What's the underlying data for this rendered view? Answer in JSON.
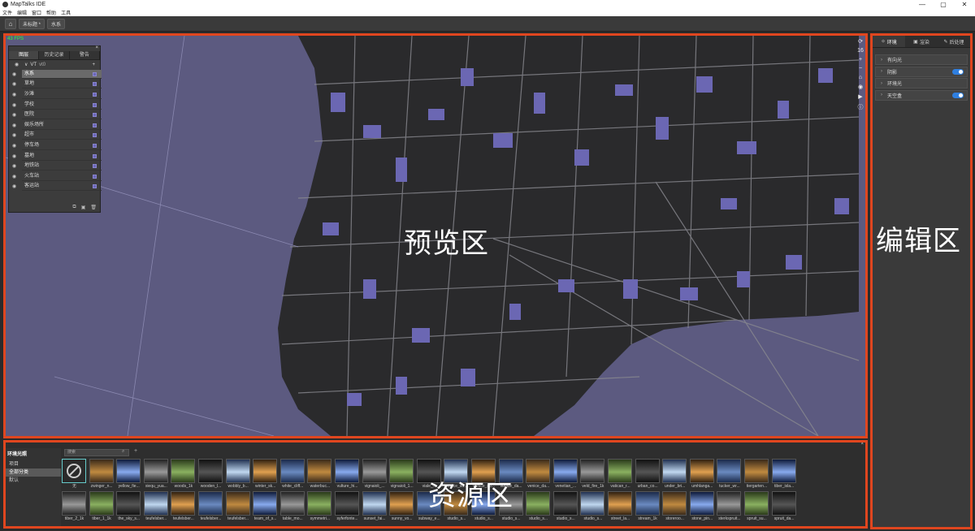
{
  "window": {
    "title": "MapTalks IDE",
    "controls": [
      "—",
      "▢",
      "✕"
    ]
  },
  "menu": [
    "文件",
    "编辑",
    "窗口",
    "帮助",
    "工具"
  ],
  "toolbar": {
    "home_icon": "home-icon",
    "scene_label": "未标题 *",
    "layer_label": "水系"
  },
  "preview": {
    "fps": "43 FPS",
    "zone_label": "预览区",
    "controls": [
      "⟳",
      "16",
      "+",
      "−",
      "⌂",
      "◉",
      "▶",
      "ⓘ"
    ]
  },
  "layers_panel": {
    "tabs": [
      "图层",
      "历史记录",
      "警告"
    ],
    "root": {
      "name": "VT",
      "sub": "vt0",
      "add": "+"
    },
    "items": [
      {
        "label": "水系",
        "active": true
      },
      {
        "label": "草地"
      },
      {
        "label": "沙滩"
      },
      {
        "label": "学校"
      },
      {
        "label": "医院"
      },
      {
        "label": "娱乐场所"
      },
      {
        "label": "超市"
      },
      {
        "label": "停车场"
      },
      {
        "label": "墓地"
      },
      {
        "label": "地铁站"
      },
      {
        "label": "火车站"
      },
      {
        "label": "客运站"
      }
    ]
  },
  "editor": {
    "zone_label": "编辑区",
    "tabs": [
      {
        "label": "环境",
        "icon": "bulb-icon"
      },
      {
        "label": "渲染",
        "icon": "camera-icon"
      },
      {
        "label": "后处理",
        "icon": "wand-icon"
      }
    ],
    "rows": [
      {
        "label": "有向光",
        "toggle": false
      },
      {
        "label": "阴影",
        "toggle": true
      },
      {
        "label": "环境光",
        "toggle": false
      },
      {
        "label": "天空盒",
        "toggle": true
      }
    ]
  },
  "assets": {
    "zone_label": "资源区",
    "side_title": "环境光照",
    "categories": [
      "项目",
      "全部分类",
      "默认"
    ],
    "search_placeholder": "搜索",
    "row1": [
      "无",
      "zwinger_n...",
      "yellow_fie...",
      "xiequ_yua...",
      "woods_1k",
      "wooden_l...",
      "wobbly_b...",
      "winter_sk...",
      "white_cliff...",
      "waterbuc...",
      "vulture_hi...",
      "vignaioli_...",
      "vignaioli_1...",
      "viale_...",
      "venice_su...",
      "venice_su...",
      "venice_da...",
      "venice_da...",
      "venetian_...",
      "veld_fire_1k",
      "vatican_r...",
      "urban_co...",
      "under_bri...",
      "umhlanga...",
      "tucker_wr...",
      "tiergarten...",
      "tiber_isla..."
    ],
    "row2": [
      "tiber_2_1k",
      "tiber_1_1k",
      "the_sky_s...",
      "teufelsber...",
      "teufelsber...",
      "teufelsber...",
      "teufelsber...",
      "team_of_s...",
      "table_mo...",
      "symmetri...",
      "syferfonte...",
      "sunset_fai...",
      "sunny_vo...",
      "subway_e...",
      "studio_s...",
      "studio_s...",
      "studio_s...",
      "studio_s...",
      "studio_s...",
      "studio_s...",
      "street_la...",
      "stream_1k",
      "storeroo...",
      "stone_pin...",
      "sterkspruit...",
      "spruit_su...",
      "spruit_da..."
    ]
  }
}
